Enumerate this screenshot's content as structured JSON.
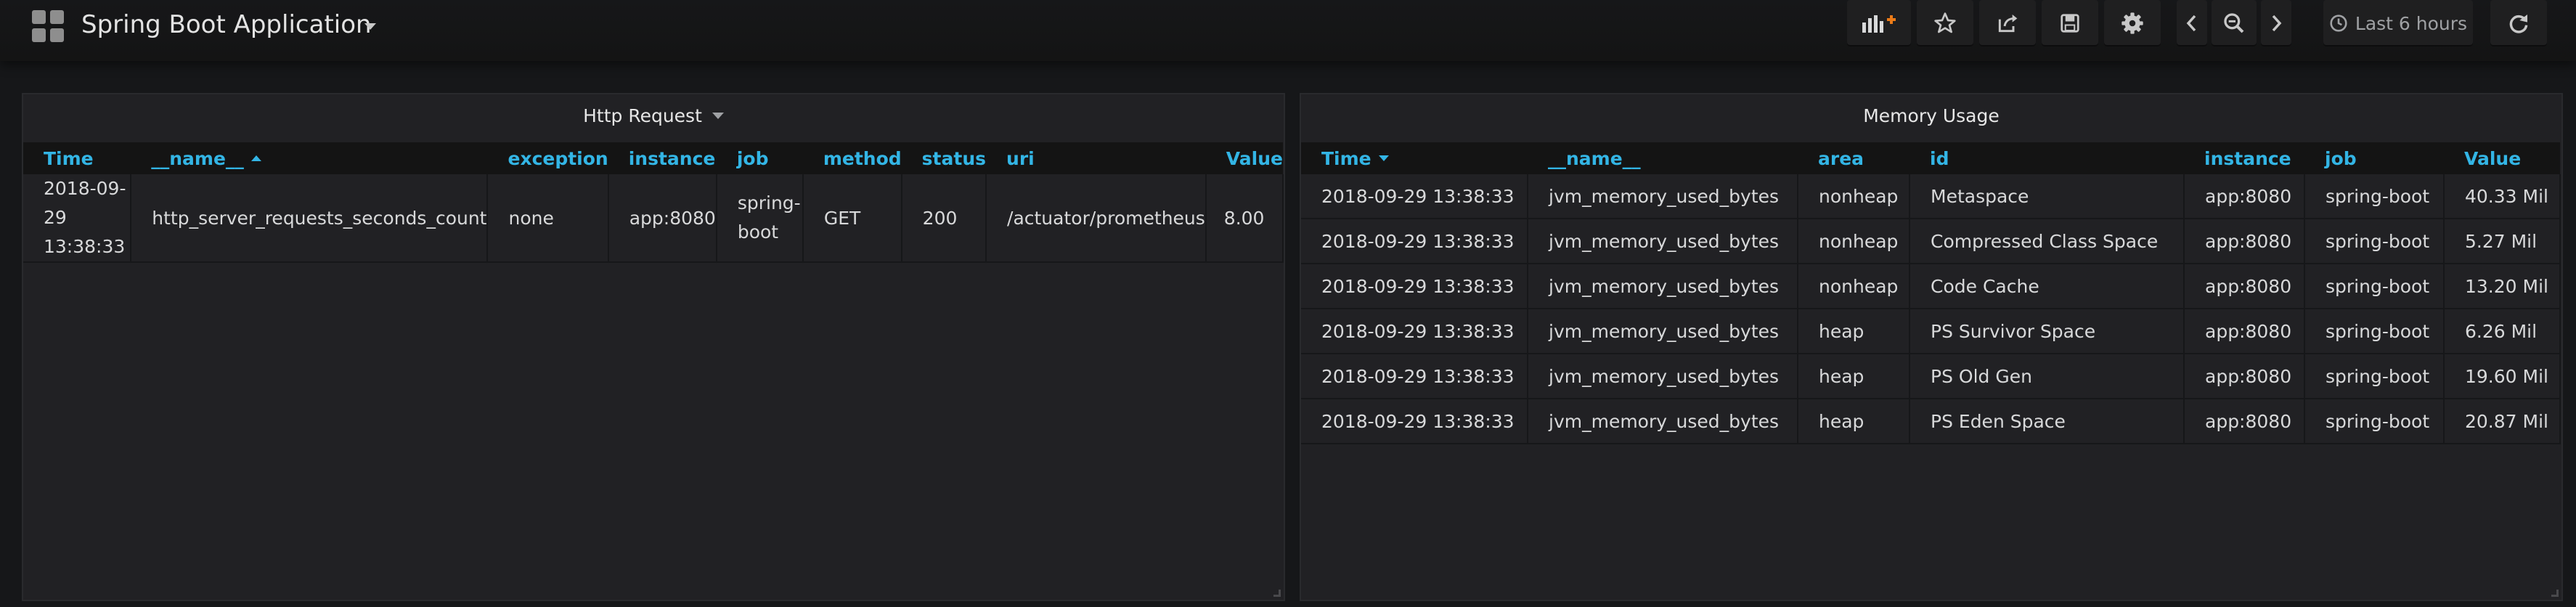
{
  "dashboard": {
    "title": "Spring Boot Application"
  },
  "toolbar": {
    "icons": [
      "add-panel-icon",
      "star-icon",
      "share-icon",
      "save-icon",
      "gear-icon",
      "chevron-left-icon",
      "zoom-out-icon",
      "chevron-right-icon",
      "clock-icon",
      "refresh-icon"
    ],
    "time_range": "Last 6 hours"
  },
  "colors": {
    "background": "#161719",
    "panel": "#212124",
    "header_row": "#141414",
    "column_header_text": "#33b5e5",
    "text": "#d8d9da"
  },
  "http_panel": {
    "title": "Http Request",
    "columns": [
      "Time",
      "__name__",
      "exception",
      "instance",
      "job",
      "method",
      "status",
      "uri",
      "Value"
    ],
    "sort_column": "__name__",
    "sort_direction": "ascending",
    "rows": [
      [
        "2018-09-29 13:38:33",
        "http_server_requests_seconds_count",
        "none",
        "app:8080",
        "spring-boot",
        "GET",
        "200",
        "/actuator/prometheus",
        "8.00"
      ]
    ]
  },
  "memory_panel": {
    "title": "Memory Usage",
    "columns": [
      "Time",
      "__name__",
      "area",
      "id",
      "instance",
      "job",
      "Value"
    ],
    "sort_column": "Time",
    "sort_direction": "descending",
    "rows": [
      [
        "2018-09-29 13:38:33",
        "jvm_memory_used_bytes",
        "nonheap",
        "Metaspace",
        "app:8080",
        "spring-boot",
        "40.33 Mil"
      ],
      [
        "2018-09-29 13:38:33",
        "jvm_memory_used_bytes",
        "nonheap",
        "Compressed Class Space",
        "app:8080",
        "spring-boot",
        "5.27 Mil"
      ],
      [
        "2018-09-29 13:38:33",
        "jvm_memory_used_bytes",
        "nonheap",
        "Code Cache",
        "app:8080",
        "spring-boot",
        "13.20 Mil"
      ],
      [
        "2018-09-29 13:38:33",
        "jvm_memory_used_bytes",
        "heap",
        "PS Survivor Space",
        "app:8080",
        "spring-boot",
        "6.26 Mil"
      ],
      [
        "2018-09-29 13:38:33",
        "jvm_memory_used_bytes",
        "heap",
        "PS Old Gen",
        "app:8080",
        "spring-boot",
        "19.60 Mil"
      ],
      [
        "2018-09-29 13:38:33",
        "jvm_memory_used_bytes",
        "heap",
        "PS Eden Space",
        "app:8080",
        "spring-boot",
        "20.87 Mil"
      ]
    ]
  }
}
